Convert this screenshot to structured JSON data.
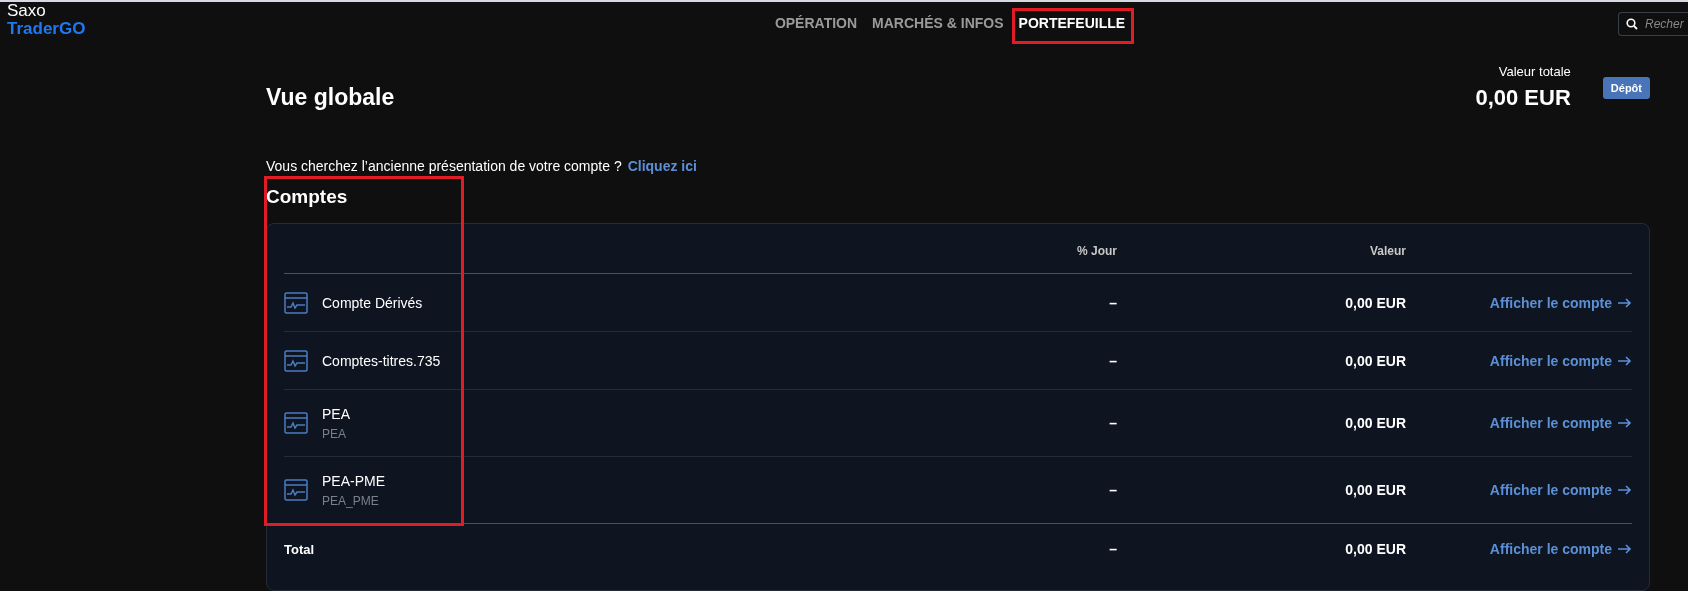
{
  "logo": {
    "line_1": "Saxo",
    "line_2": "TraderGO"
  },
  "nav": [
    {
      "label": "OPÉRATION",
      "selected": false
    },
    {
      "label": "MARCHÉS & INFOS",
      "selected": false
    },
    {
      "label": "PORTEFEUILLE",
      "selected": true
    }
  ],
  "search": {
    "placeholder": "Recher"
  },
  "page": {
    "title": "Vue globale",
    "total_label": "Valeur totale",
    "total_value": "0,00 EUR",
    "deposit_button": "Dépôt"
  },
  "notice": {
    "text": "Vous cherchez l’ancienne présentation de votre compte ?",
    "link": "Cliquez ici"
  },
  "accounts": {
    "title": "Comptes",
    "columns": [
      "% Jour",
      "Valeur"
    ],
    "rows": [
      {
        "name": "Compte Dérivés",
        "day": "–",
        "value": "0,00 EUR",
        "link": "Afficher le compte"
      },
      {
        "name": "Comptes-titres.735",
        "day": "–",
        "value": "0,00 EUR",
        "link": "Afficher le compte"
      },
      {
        "name": "PEA",
        "subtitle": "PEA",
        "day": "–",
        "value": "0,00 EUR",
        "link": "Afficher le compte"
      },
      {
        "name": "PEA-PME",
        "subtitle": "PEA_PME",
        "day": "–",
        "value": "0,00 EUR",
        "link": "Afficher le compte"
      }
    ],
    "total": {
      "label": "Total",
      "day": "–",
      "value": "0,00 EUR",
      "link": "Afficher le compte"
    }
  }
}
